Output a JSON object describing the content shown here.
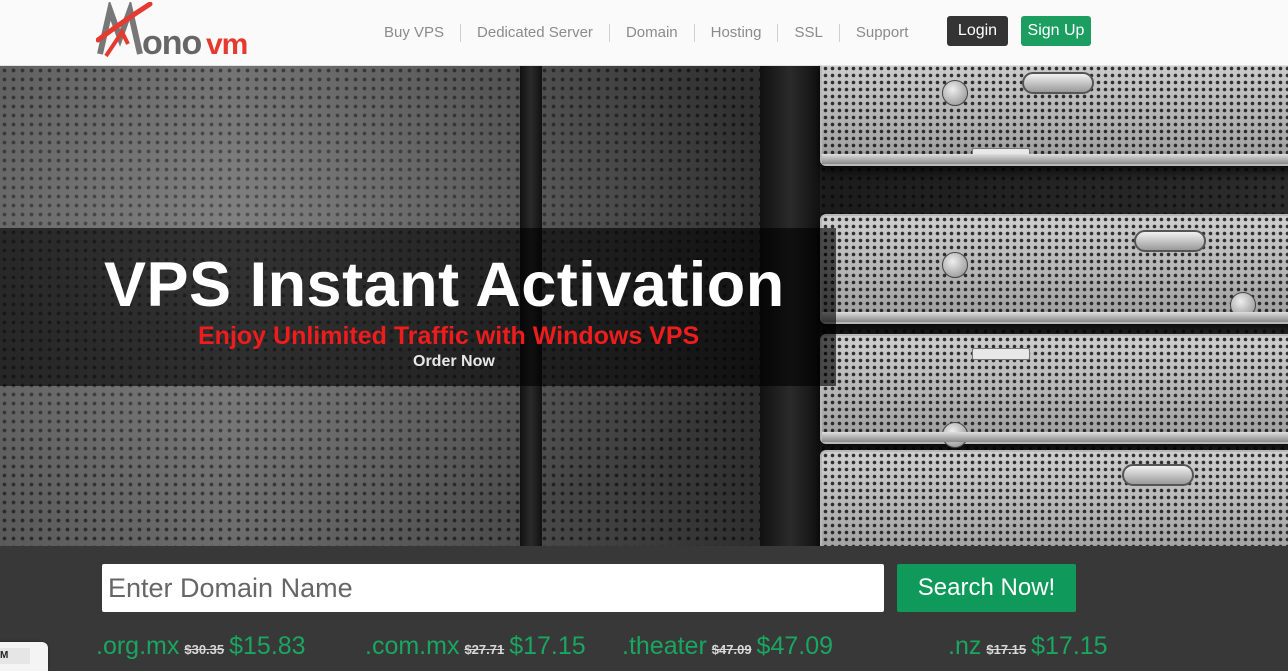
{
  "header": {
    "logo_text": "Monovm",
    "nav": [
      {
        "label": "Buy VPS"
      },
      {
        "label": "Dedicated Server"
      },
      {
        "label": "Domain"
      },
      {
        "label": "Hosting"
      },
      {
        "label": "SSL"
      },
      {
        "label": "Support"
      }
    ],
    "login_label": "Login",
    "signup_label": "Sign Up"
  },
  "hero": {
    "title": "VPS Instant Activation",
    "subtitle": "Enjoy Unlimited Traffic with Windows VPS",
    "cta": "Order Now"
  },
  "search": {
    "placeholder": "Enter Domain Name",
    "button_label": "Search Now!"
  },
  "tlds": [
    {
      "name": ".org.mx",
      "old_price": "$30.35",
      "new_price": "$15.83"
    },
    {
      "name": ".com.mx",
      "old_price": "$27.71",
      "new_price": "$17.15"
    },
    {
      "name": ".theater",
      "old_price": "$47.09",
      "new_price": "$47.09"
    },
    {
      "name": ".nz",
      "old_price": "$17.15",
      "new_price": "$17.15"
    }
  ],
  "corner_widget": {
    "text": "M"
  },
  "colors": {
    "brand_red": "#e53a2f",
    "brand_green": "#1b9e5f",
    "price_green": "#18a660",
    "subtitle_red": "#ee1c1c",
    "login_bg": "#343434"
  }
}
